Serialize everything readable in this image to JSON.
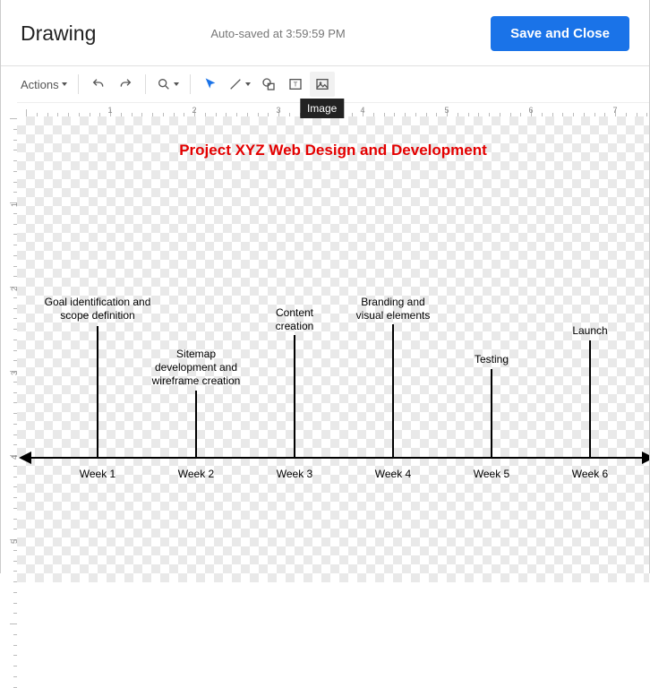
{
  "header": {
    "title": "Drawing",
    "autosave": "Auto-saved at 3:59:59 PM",
    "save_button": "Save and Close"
  },
  "toolbar": {
    "actions_label": "Actions",
    "tooltip_image": "Image"
  },
  "canvas": {
    "title": "Project XYZ Web Design and Development"
  },
  "timeline": {
    "weeks": [
      "Week 1",
      "Week 2",
      "Week 3",
      "Week 4",
      "Week 5",
      "Week 6"
    ],
    "milestones": [
      {
        "label": "Goal identification and\nscope definition"
      },
      {
        "label": "Sitemap\ndevelopment and\nwireframe creation"
      },
      {
        "label": "Content\ncreation"
      },
      {
        "label": "Branding and\nvisual elements"
      },
      {
        "label": "Testing"
      },
      {
        "label": "Launch"
      }
    ]
  },
  "ruler_h": [
    "1",
    "2",
    "3",
    "4",
    "5",
    "6",
    "7"
  ],
  "ruler_v": [
    "1",
    "2",
    "3",
    "4",
    "5"
  ]
}
